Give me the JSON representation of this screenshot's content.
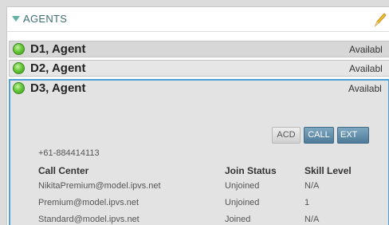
{
  "panel": {
    "title": "AGENTS"
  },
  "agents": [
    {
      "name": "D1, Agent",
      "status": "Availabl"
    },
    {
      "name": "D2, Agent",
      "status": "Availabl"
    }
  ],
  "expanded_agent": {
    "name": "D3, Agent",
    "status": "Availabl",
    "buttons": {
      "acd": "ACD",
      "call": "CALL",
      "ext": "EXT"
    },
    "phone": "+61-884414113",
    "table": {
      "headers": [
        "Call Center",
        "Join Status",
        "Skill Level"
      ],
      "rows": [
        [
          "NikitaPremium@model.ipvs.net",
          "Unjoined",
          "N/A"
        ],
        [
          "Premium@model.ipvs.net",
          "Unjoined",
          "1"
        ],
        [
          "Standard@model.ipvs.net",
          "Joined",
          "N/A"
        ]
      ]
    }
  },
  "colors": {
    "accent_border": "#4aa3d4",
    "status_available": "#67c83a",
    "header_text": "#3d6d73"
  },
  "icons": {
    "collapse": "triangle-down-icon",
    "edit": "pencil-icon",
    "status": "available-status-icon"
  }
}
